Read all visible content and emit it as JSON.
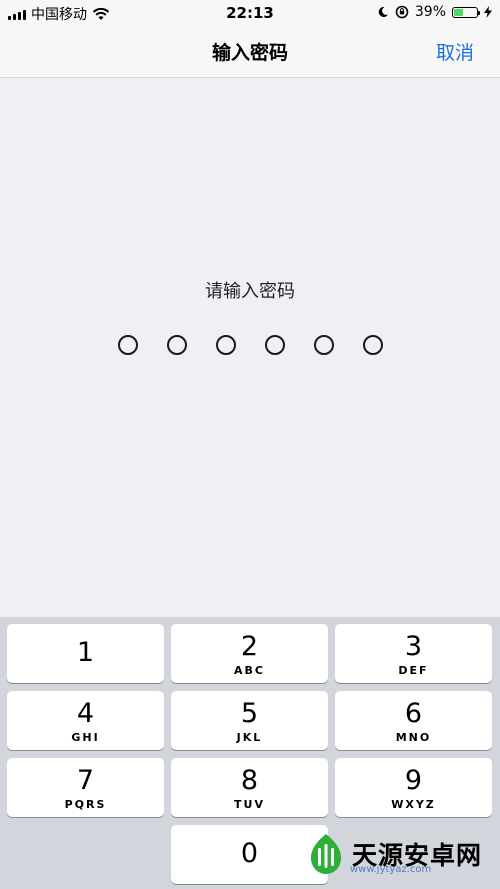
{
  "status_bar": {
    "carrier": "中国移动",
    "time": "22:13",
    "battery_percent": "39%",
    "battery_level": 0.39,
    "icons": [
      "signal-icon",
      "wifi-icon",
      "moon-icon",
      "rotation-lock-icon",
      "battery-icon",
      "charging-icon"
    ]
  },
  "nav": {
    "title": "输入密码",
    "cancel_label": "取消"
  },
  "prompt": {
    "text": "请输入密码",
    "digits_count": 6,
    "digits_entered": 0
  },
  "keypad": {
    "keys": [
      {
        "digit": "1",
        "letters": ""
      },
      {
        "digit": "2",
        "letters": "ABC"
      },
      {
        "digit": "3",
        "letters": "DEF"
      },
      {
        "digit": "4",
        "letters": "GHI"
      },
      {
        "digit": "5",
        "letters": "JKL"
      },
      {
        "digit": "6",
        "letters": "MNO"
      },
      {
        "digit": "7",
        "letters": "PQRS"
      },
      {
        "digit": "8",
        "letters": "TUV"
      },
      {
        "digit": "9",
        "letters": "WXYZ"
      },
      {
        "digit": "0",
        "letters": ""
      }
    ]
  },
  "watermark": {
    "name": "天源安卓网",
    "url": "www.jytyaz.com"
  },
  "colors": {
    "accent": "#1e6fd9",
    "battery": "#4cd964",
    "keypad_bg": "#d2d5db",
    "page_bg": "#efeff4"
  }
}
